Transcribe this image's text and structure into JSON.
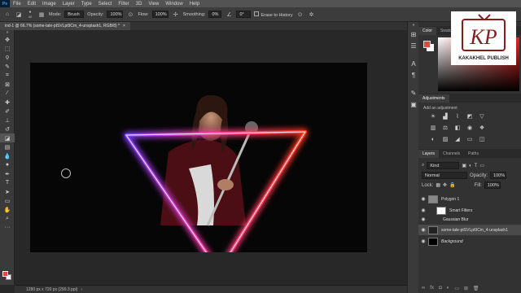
{
  "menubar": {
    "logo": "Ps",
    "items": [
      "File",
      "Edit",
      "Image",
      "Layer",
      "Type",
      "Select",
      "Filter",
      "3D",
      "View",
      "Window",
      "Help"
    ]
  },
  "options": {
    "brush_size": "40",
    "mode_label": "Mode:",
    "mode_value": "Brush",
    "opacity_label": "Opacity:",
    "opacity_value": "100%",
    "flow_label": "Flow:",
    "flow_value": "100%",
    "smoothing_label": "Smoothing:",
    "smoothing_value": "0%",
    "angle_value": "0°",
    "erase_history_label": "Erase to History"
  },
  "document": {
    "tab_title": "ind-1 @ 66.7% (some-tale-ptSVLpt9Cm_4-unsplash1, RGB/8) *",
    "close": "×",
    "status": "1280 px x 720 px (299.3 ppi)"
  },
  "color_panel": {
    "tabs": [
      "Color",
      "Swatches"
    ],
    "fg_color": "#e8463c",
    "bg_color": "#ffffff"
  },
  "watermark": {
    "brand": "KAKAKHEL PUBLISH",
    "monogram": "KP"
  },
  "adjustments": {
    "title": "Adjustments",
    "subtitle": "Add an adjustment"
  },
  "layers": {
    "tabs": [
      "Layers",
      "Channels",
      "Paths"
    ],
    "kind_label": "Kind",
    "blend_mode": "Normal",
    "opacity_label": "Opacity:",
    "opacity_value": "100%",
    "lock_label": "Lock:",
    "fill_label": "Fill:",
    "fill_value": "100%",
    "items": [
      {
        "name": "Polygon 1",
        "type": "shape"
      },
      {
        "name": "Smart Filters",
        "type": "filter-group"
      },
      {
        "name": "Gaussian Blur",
        "type": "filter"
      },
      {
        "name": "some-tale-ptSVLpt9Cm_4-unsplash1",
        "type": "smart-object"
      },
      {
        "name": "Background",
        "type": "background"
      }
    ]
  },
  "accent": {
    "neon_start": "#8a2be2",
    "neon_mid": "#ff3ca0",
    "neon_end": "#ff3b1e"
  }
}
